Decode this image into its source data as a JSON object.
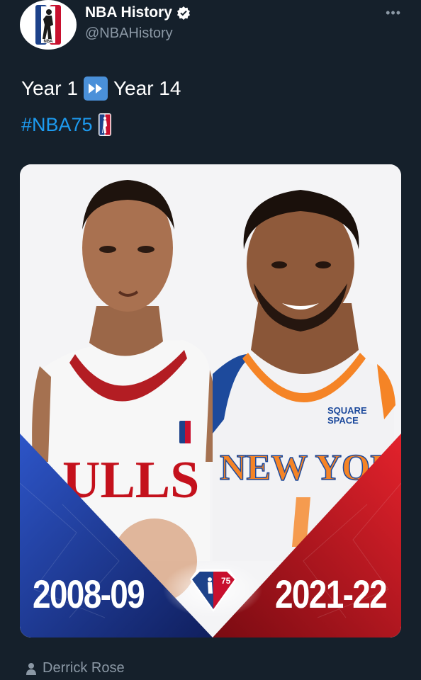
{
  "account": {
    "display_name": "NBA History",
    "handle": "@NBAHistory",
    "more_label": "•••"
  },
  "tweet": {
    "year_start": "Year 1",
    "year_end": "Year 14",
    "hashtag": "#NBA75"
  },
  "media": {
    "left_jersey_text": "ULLS",
    "right_jersey_text": "NEW YORK",
    "sponsor_line1": "SQUARE",
    "sponsor_line2": "SPACE",
    "season_left": "2008-09",
    "season_right": "2021-22",
    "badge_text": "75",
    "colors": {
      "left_panel": "#1f3f9e",
      "right_panel": "#c4111c",
      "link": "#1d9bf0",
      "background": "#15202b"
    }
  },
  "caption": {
    "text": "Derrick Rose"
  },
  "icons": [
    "nba-logo-icon",
    "verified-badge-icon",
    "more-options-icon",
    "fast-forward-icon",
    "nba-logo-emoji-icon",
    "nba75-logo-icon",
    "person-icon"
  ]
}
